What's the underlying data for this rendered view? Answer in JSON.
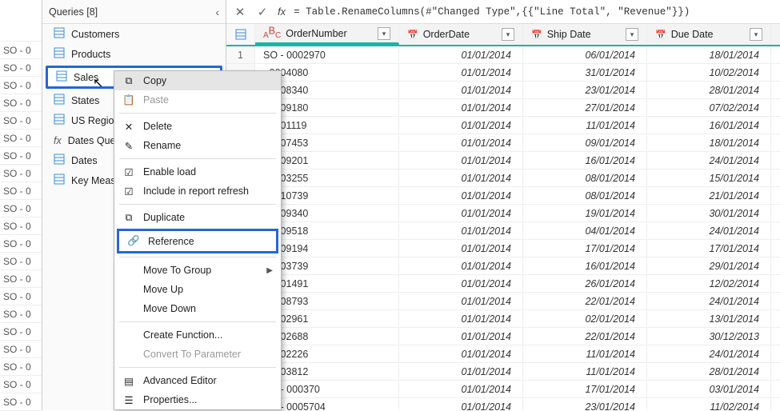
{
  "left_rows": [
    "",
    "SO - 0",
    "SO - 0",
    "SO - 0",
    "SO - 0",
    "SO - 0",
    "SO - 0",
    "SO - 0",
    "SO - 0",
    "SO - 0",
    "SO - 0",
    "SO - 0",
    "SO - 0",
    "SO - 0",
    "SO - 0",
    "SO - 0",
    "SO - 0",
    "SO - 0",
    "SO - 0",
    "SO - 0",
    "SO - 0",
    "SO - 0"
  ],
  "queries_title": "Queries [8]",
  "queries": [
    {
      "label": "Customers",
      "icon": "table"
    },
    {
      "label": "Products",
      "icon": "table"
    },
    {
      "label": "Sales",
      "icon": "table",
      "hl": true
    },
    {
      "label": "States",
      "icon": "table"
    },
    {
      "label": "US Regions",
      "icon": "table"
    },
    {
      "label": "Dates Query",
      "icon": "fx"
    },
    {
      "label": "Dates",
      "icon": "table"
    },
    {
      "label": "Key Measur",
      "icon": "table"
    }
  ],
  "formula": "= Table.RenameColumns(#\"Changed Type\",{{\"Line Total\", \"Revenue\"}})",
  "columns": [
    "OrderNumber",
    "OrderDate",
    "Ship Date",
    "Due Date"
  ],
  "rows": [
    {
      "i": "1",
      "n": "SO - 0002970",
      "d1": "01/01/2014",
      "d2": "06/01/2014",
      "d3": "18/01/2014"
    },
    {
      "i": "",
      "n": "- 0004080",
      "d1": "01/01/2014",
      "d2": "31/01/2014",
      "d3": "10/02/2014"
    },
    {
      "i": "",
      "n": "- 0008340",
      "d1": "01/01/2014",
      "d2": "23/01/2014",
      "d3": "28/01/2014"
    },
    {
      "i": "",
      "n": "- 0009180",
      "d1": "01/01/2014",
      "d2": "27/01/2014",
      "d3": "07/02/2014"
    },
    {
      "i": "",
      "n": "- 0001119",
      "d1": "01/01/2014",
      "d2": "11/01/2014",
      "d3": "16/01/2014"
    },
    {
      "i": "",
      "n": "- 0007453",
      "d1": "01/01/2014",
      "d2": "09/01/2014",
      "d3": "18/01/2014"
    },
    {
      "i": "",
      "n": "- 0009201",
      "d1": "01/01/2014",
      "d2": "16/01/2014",
      "d3": "24/01/2014"
    },
    {
      "i": "",
      "n": "- 0003255",
      "d1": "01/01/2014",
      "d2": "08/01/2014",
      "d3": "15/01/2014"
    },
    {
      "i": "",
      "n": "- 0010739",
      "d1": "01/01/2014",
      "d2": "08/01/2014",
      "d3": "21/01/2014"
    },
    {
      "i": "",
      "n": "- 0009340",
      "d1": "01/01/2014",
      "d2": "19/01/2014",
      "d3": "30/01/2014"
    },
    {
      "i": "",
      "n": "- 0009518",
      "d1": "01/01/2014",
      "d2": "04/01/2014",
      "d3": "24/01/2014"
    },
    {
      "i": "",
      "n": "- 0009194",
      "d1": "01/01/2014",
      "d2": "17/01/2014",
      "d3": "17/01/2014"
    },
    {
      "i": "",
      "n": "- 0003739",
      "d1": "01/01/2014",
      "d2": "16/01/2014",
      "d3": "29/01/2014"
    },
    {
      "i": "",
      "n": "- 0001491",
      "d1": "01/01/2014",
      "d2": "26/01/2014",
      "d3": "12/02/2014"
    },
    {
      "i": "",
      "n": "- 0008793",
      "d1": "01/01/2014",
      "d2": "22/01/2014",
      "d3": "24/01/2014"
    },
    {
      "i": "",
      "n": "- 0002961",
      "d1": "01/01/2014",
      "d2": "02/01/2014",
      "d3": "13/01/2014"
    },
    {
      "i": "",
      "n": "- 0002688",
      "d1": "01/01/2014",
      "d2": "22/01/2014",
      "d3": "30/12/2013"
    },
    {
      "i": "",
      "n": "- 0002226",
      "d1": "01/01/2014",
      "d2": "11/01/2014",
      "d3": "24/01/2014"
    },
    {
      "i": "",
      "n": "- 0003812",
      "d1": "01/01/2014",
      "d2": "11/01/2014",
      "d3": "28/01/2014"
    },
    {
      "i": "20",
      "n": "SO - 000370",
      "d1": "01/01/2014",
      "d2": "17/01/2014",
      "d3": "03/01/2014"
    },
    {
      "i": "21",
      "n": "SO - 0005704",
      "d1": "01/01/2014",
      "d2": "23/01/2014",
      "d3": "11/02/2014"
    }
  ],
  "ctx": {
    "copy": "Copy",
    "paste": "Paste",
    "delete": "Delete",
    "rename": "Rename",
    "enable": "Enable load",
    "include": "Include in report refresh",
    "duplicate": "Duplicate",
    "reference": "Reference",
    "movegroup": "Move To Group",
    "moveup": "Move Up",
    "movedown": "Move Down",
    "createfn": "Create Function...",
    "convert": "Convert To Parameter",
    "adv": "Advanced Editor",
    "props": "Properties..."
  }
}
